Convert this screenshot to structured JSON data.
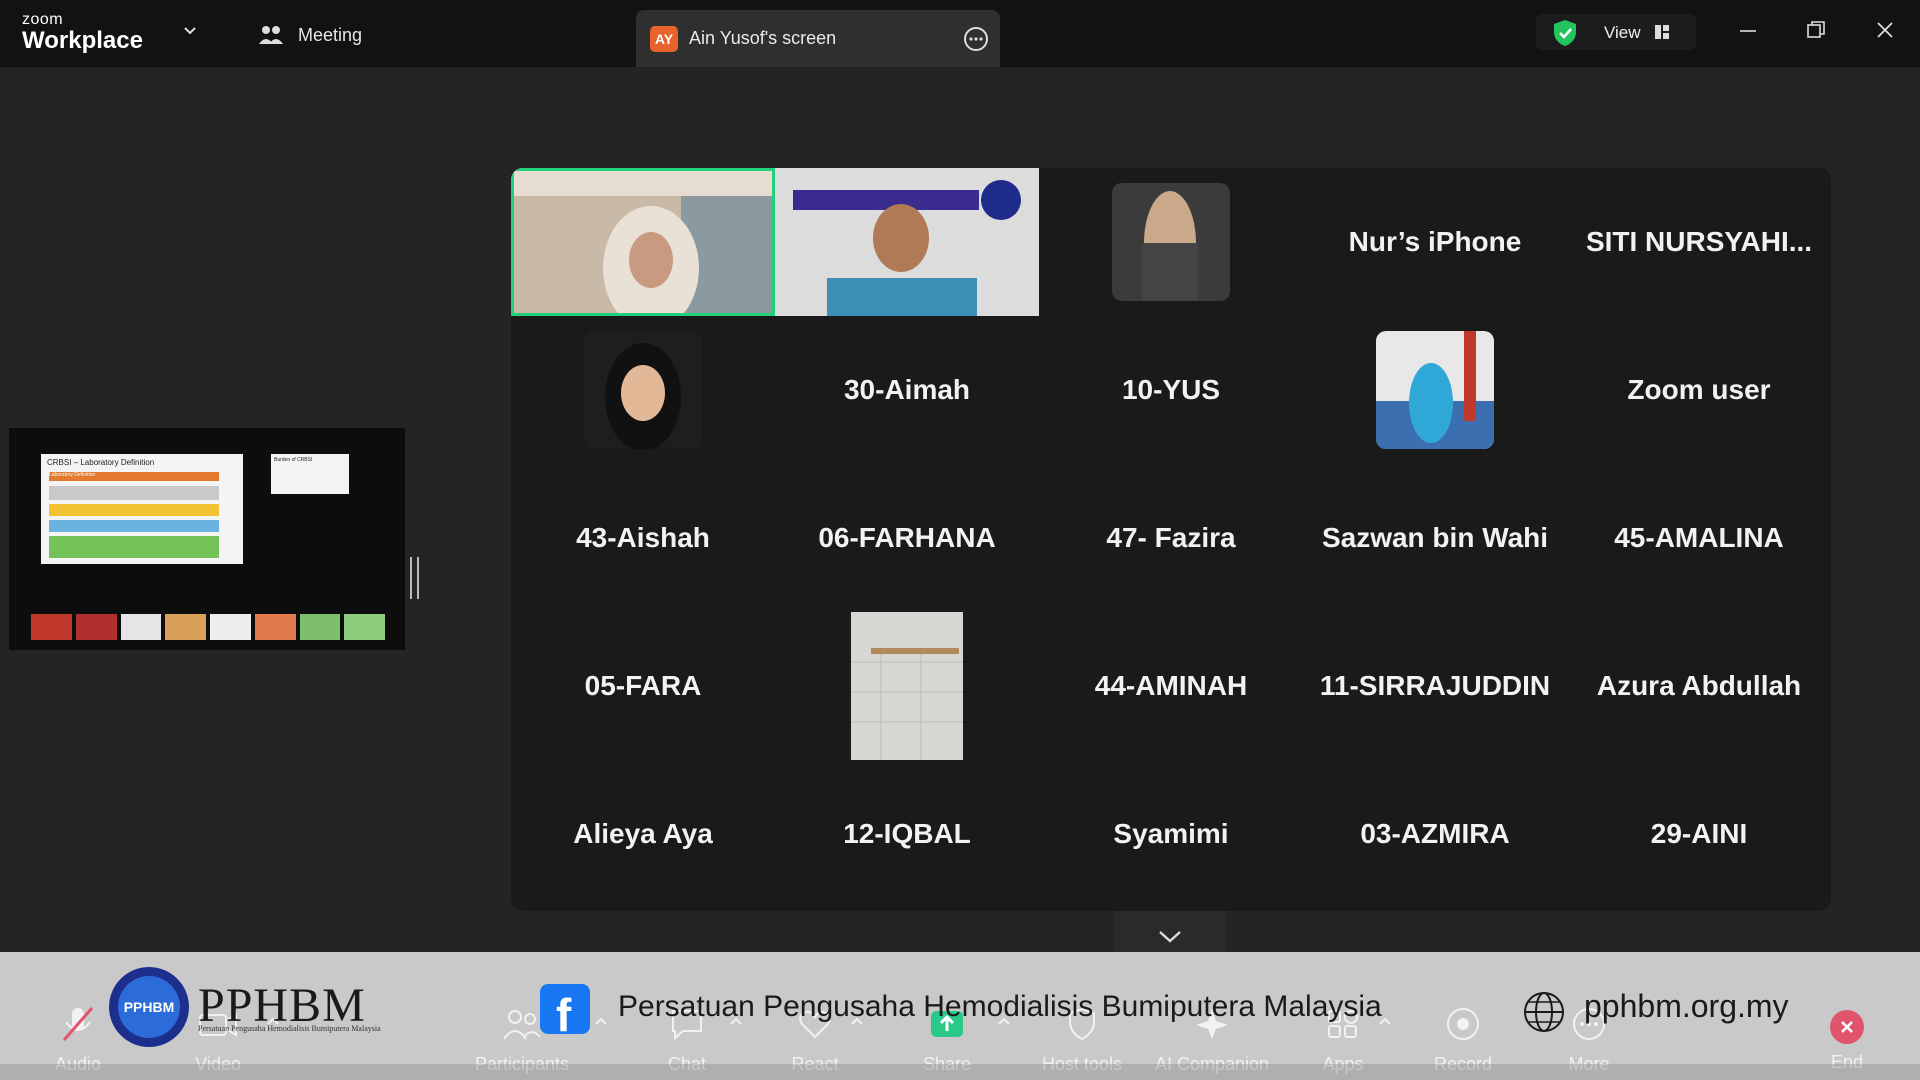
{
  "titlebar": {
    "brand_top": "zoom",
    "brand_bottom": "Workplace",
    "meeting_label": "Meeting",
    "share_avatar_initials": "AY",
    "share_tab_label": "Ain Yusof's screen",
    "view_label": "View"
  },
  "gallery": {
    "tiles": [
      {
        "name": "",
        "kind": "video",
        "active": true
      },
      {
        "name": "",
        "kind": "video"
      },
      {
        "name": "",
        "kind": "photo"
      },
      {
        "name": "Nur’s iPhone",
        "kind": "name"
      },
      {
        "name": "SITI  NURSYAHI...",
        "kind": "name"
      },
      {
        "name": "",
        "kind": "photo"
      },
      {
        "name": "30-Aimah",
        "kind": "name"
      },
      {
        "name": "10-YUS",
        "kind": "name"
      },
      {
        "name": "",
        "kind": "photo"
      },
      {
        "name": "Zoom user",
        "kind": "name"
      },
      {
        "name": "43-Aishah",
        "kind": "name"
      },
      {
        "name": "06-FARHANA",
        "kind": "name"
      },
      {
        "name": "47- Fazira",
        "kind": "name"
      },
      {
        "name": "Sazwan bin Wahi",
        "kind": "name"
      },
      {
        "name": "45-AMALINA",
        "kind": "name"
      },
      {
        "name": "05-FARA",
        "kind": "name"
      },
      {
        "name": "",
        "kind": "photo"
      },
      {
        "name": "44-AMINAH",
        "kind": "name"
      },
      {
        "name": "11-SIRRAJUDDIN",
        "kind": "name"
      },
      {
        "name": "Azura Abdullah",
        "kind": "name"
      },
      {
        "name": "Alieya Aya",
        "kind": "name"
      },
      {
        "name": "12-IQBAL",
        "kind": "name"
      },
      {
        "name": "Syamimi",
        "kind": "name"
      },
      {
        "name": "03-AZMIRA",
        "kind": "name"
      },
      {
        "name": "29-AINI",
        "kind": "name"
      }
    ]
  },
  "shared_screen": {
    "slide_title": "CRBSI – Laboratory Definition",
    "slide_header": "Laboratory Definition",
    "next_slide_label": "Burden of CRBSI"
  },
  "toolbar": {
    "audio": "Audio",
    "video": "Video",
    "participants": "Participants",
    "chat": "Chat",
    "react": "React",
    "share": "Share",
    "host_tools": "Host tools",
    "ai_companion": "AI Companion",
    "apps": "Apps",
    "record": "Record",
    "more": "More",
    "end": "End"
  },
  "banner": {
    "logo_text": "PPHBM",
    "brand": "PPHBM",
    "sub": "Persatuan Pengusaha Hemodialisis Bumiputera Malaysia",
    "facebook_glyph": "f",
    "org_name": "Persatuan Pengusaha Hemodialisis Bumiputera Malaysia",
    "website": "pphbm.org.my"
  },
  "colors": {
    "active_speaker": "#21d07a",
    "share_avatar": "#e8622c",
    "end_button": "#e0556b",
    "facebook": "#1877f2"
  }
}
